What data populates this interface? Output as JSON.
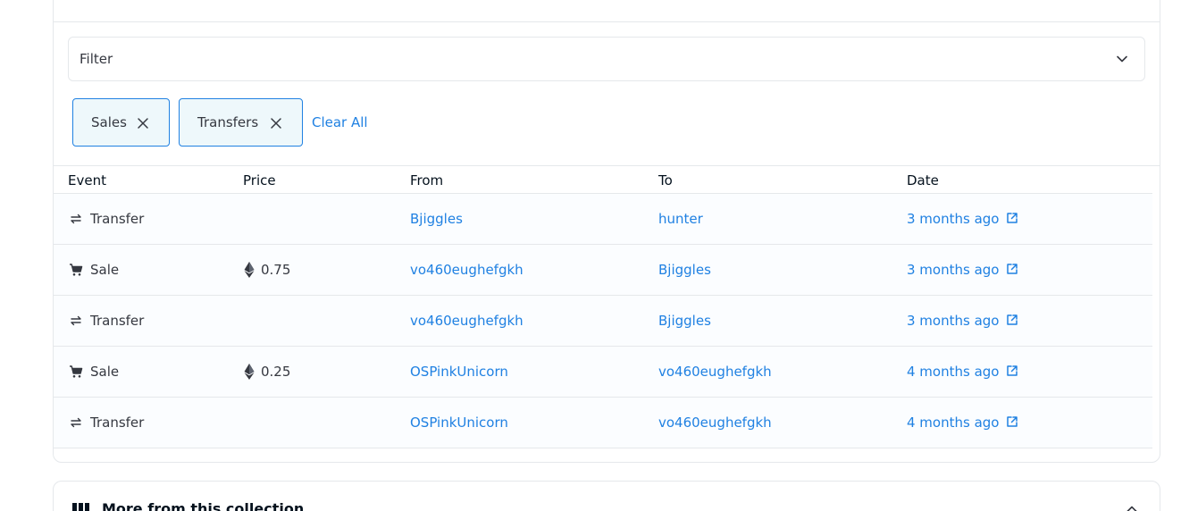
{
  "filter": {
    "label": "Filter"
  },
  "chips": [
    {
      "label": "Sales"
    },
    {
      "label": "Transfers"
    }
  ],
  "clear_all": "Clear All",
  "table": {
    "headers": [
      "Event",
      "Price",
      "From",
      "To",
      "Date"
    ],
    "rows": [
      {
        "event": "Transfer",
        "event_icon": "transfer-icon",
        "price": "",
        "from": "Bjiggles",
        "to": "hunter",
        "date": "3 months ago"
      },
      {
        "event": "Sale",
        "event_icon": "cart-icon",
        "price": "0.75",
        "from": "vo460eughefgkh",
        "to": "Bjiggles",
        "date": "3 months ago"
      },
      {
        "event": "Transfer",
        "event_icon": "transfer-icon",
        "price": "",
        "from": "vo460eughefgkh",
        "to": "Bjiggles",
        "date": "3 months ago"
      },
      {
        "event": "Sale",
        "event_icon": "cart-icon",
        "price": "0.25",
        "from": "OSPinkUnicorn",
        "to": "vo460eughefgkh",
        "date": "4 months ago"
      },
      {
        "event": "Transfer",
        "event_icon": "transfer-icon",
        "price": "",
        "from": "OSPinkUnicorn",
        "to": "vo460eughefgkh",
        "date": "4 months ago"
      }
    ]
  },
  "more_collection": {
    "title": "More from this collection"
  },
  "colors": {
    "link": "#2081e2",
    "text": "#353840",
    "border": "#e5e8eb",
    "chip_bg": "#eef8fb"
  }
}
